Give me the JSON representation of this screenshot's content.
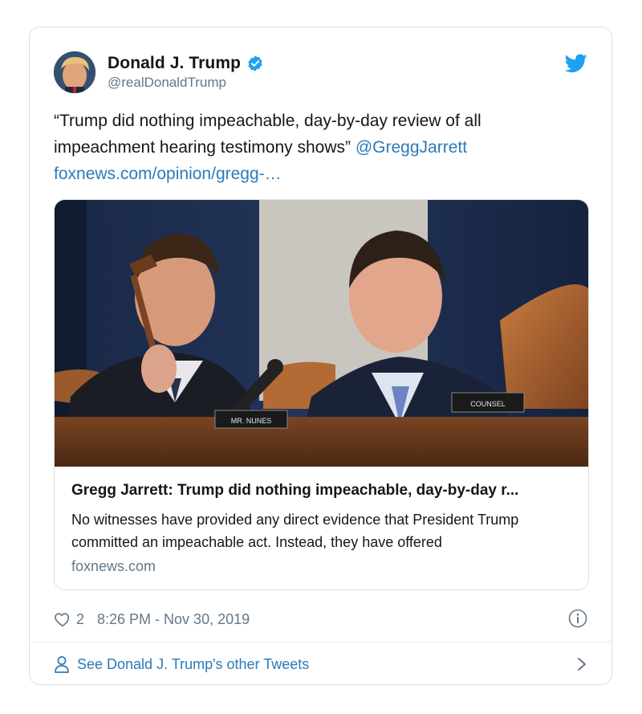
{
  "author": {
    "display_name": "Donald J. Trump",
    "handle": "@realDonaldTrump",
    "verified": true
  },
  "tweet": {
    "text_before_mention": "“Trump did nothing impeachable, day-by-day review of all impeachment hearing testimony shows” ",
    "mention": "@GreggJarrett",
    "link_text": "foxnews.com/opinion/gregg-…"
  },
  "link_card": {
    "title": "Gregg Jarrett: Trump did nothing impeachable, day-by-day r...",
    "description": "No witnesses have provided any direct evidence that President Trump committed an impeachable act. Instead, they have offered",
    "domain": "foxnews.com",
    "image_placard_left": "MR. NUNES",
    "image_placard_right": "COUNSEL"
  },
  "meta": {
    "like_count": "2",
    "timestamp": "8:26 PM - Nov 30, 2019"
  },
  "footer": {
    "see_more_label": "See Donald J. Trump's other Tweets"
  },
  "colors": {
    "brand_blue": "#1da1f2",
    "link_blue": "#2b7bb9",
    "secondary_text": "#657786",
    "border": "#d9dee3"
  },
  "icons": {
    "verified": "verified-badge-icon",
    "bird": "twitter-bird-icon",
    "like": "heart-icon",
    "info": "info-icon",
    "profile": "person-icon",
    "chevron": "chevron-right-icon"
  }
}
